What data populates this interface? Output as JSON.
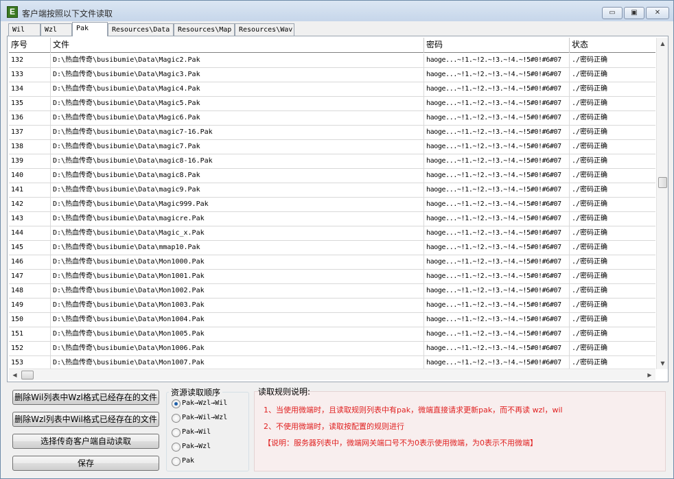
{
  "window": {
    "title": "客户端按照以下文件读取",
    "app_icon": "E",
    "minimize": "▭",
    "maximize": "▣",
    "close": "✕"
  },
  "tabs": [
    {
      "label": "Wil",
      "active": false
    },
    {
      "label": "Wzl",
      "active": false
    },
    {
      "label": "Pak",
      "active": true
    },
    {
      "label": "Resources\\Data",
      "active": false
    },
    {
      "label": "Resources\\Map",
      "active": false
    },
    {
      "label": "Resources\\Wav",
      "active": false
    }
  ],
  "table": {
    "columns": [
      "序号",
      "文件",
      "密码",
      "状态"
    ],
    "rows": [
      {
        "no": "132",
        "file": "D:\\热血传奇\\busibumie\\Data\\Magic2.Pak",
        "password": "haoge...~!1.~!2.~!3.~!4.~!5#0!#6#07",
        "status": "./密码正确"
      },
      {
        "no": "133",
        "file": "D:\\热血传奇\\busibumie\\Data\\Magic3.Pak",
        "password": "haoge...~!1.~!2.~!3.~!4.~!5#0!#6#07",
        "status": "./密码正确"
      },
      {
        "no": "134",
        "file": "D:\\热血传奇\\busibumie\\Data\\Magic4.Pak",
        "password": "haoge...~!1.~!2.~!3.~!4.~!5#0!#6#07",
        "status": "./密码正确"
      },
      {
        "no": "135",
        "file": "D:\\热血传奇\\busibumie\\Data\\Magic5.Pak",
        "password": "haoge...~!1.~!2.~!3.~!4.~!5#0!#6#07",
        "status": "./密码正确"
      },
      {
        "no": "136",
        "file": "D:\\热血传奇\\busibumie\\Data\\Magic6.Pak",
        "password": "haoge...~!1.~!2.~!3.~!4.~!5#0!#6#07",
        "status": "./密码正确"
      },
      {
        "no": "137",
        "file": "D:\\热血传奇\\busibumie\\Data\\magic7-16.Pak",
        "password": "haoge...~!1.~!2.~!3.~!4.~!5#0!#6#07",
        "status": "./密码正确"
      },
      {
        "no": "138",
        "file": "D:\\热血传奇\\busibumie\\Data\\magic7.Pak",
        "password": "haoge...~!1.~!2.~!3.~!4.~!5#0!#6#07",
        "status": "./密码正确"
      },
      {
        "no": "139",
        "file": "D:\\热血传奇\\busibumie\\Data\\magic8-16.Pak",
        "password": "haoge...~!1.~!2.~!3.~!4.~!5#0!#6#07",
        "status": "./密码正确"
      },
      {
        "no": "140",
        "file": "D:\\热血传奇\\busibumie\\Data\\magic8.Pak",
        "password": "haoge...~!1.~!2.~!3.~!4.~!5#0!#6#07",
        "status": "./密码正确"
      },
      {
        "no": "141",
        "file": "D:\\热血传奇\\busibumie\\Data\\magic9.Pak",
        "password": "haoge...~!1.~!2.~!3.~!4.~!5#0!#6#07",
        "status": "./密码正确"
      },
      {
        "no": "142",
        "file": "D:\\热血传奇\\busibumie\\Data\\Magic999.Pak",
        "password": "haoge...~!1.~!2.~!3.~!4.~!5#0!#6#07",
        "status": "./密码正确"
      },
      {
        "no": "143",
        "file": "D:\\热血传奇\\busibumie\\Data\\magicre.Pak",
        "password": "haoge...~!1.~!2.~!3.~!4.~!5#0!#6#07",
        "status": "./密码正确"
      },
      {
        "no": "144",
        "file": "D:\\热血传奇\\busibumie\\Data\\Magic_x.Pak",
        "password": "haoge...~!1.~!2.~!3.~!4.~!5#0!#6#07",
        "status": "./密码正确"
      },
      {
        "no": "145",
        "file": "D:\\热血传奇\\busibumie\\Data\\mmap10.Pak",
        "password": "haoge...~!1.~!2.~!3.~!4.~!5#0!#6#07",
        "status": "./密码正确"
      },
      {
        "no": "146",
        "file": "D:\\热血传奇\\busibumie\\Data\\Mon1000.Pak",
        "password": "haoge...~!1.~!2.~!3.~!4.~!5#0!#6#07",
        "status": "./密码正确"
      },
      {
        "no": "147",
        "file": "D:\\热血传奇\\busibumie\\Data\\Mon1001.Pak",
        "password": "haoge...~!1.~!2.~!3.~!4.~!5#0!#6#07",
        "status": "./密码正确"
      },
      {
        "no": "148",
        "file": "D:\\热血传奇\\busibumie\\Data\\Mon1002.Pak",
        "password": "haoge...~!1.~!2.~!3.~!4.~!5#0!#6#07",
        "status": "./密码正确"
      },
      {
        "no": "149",
        "file": "D:\\热血传奇\\busibumie\\Data\\Mon1003.Pak",
        "password": "haoge...~!1.~!2.~!3.~!4.~!5#0!#6#07",
        "status": "./密码正确"
      },
      {
        "no": "150",
        "file": "D:\\热血传奇\\busibumie\\Data\\Mon1004.Pak",
        "password": "haoge...~!1.~!2.~!3.~!4.~!5#0!#6#07",
        "status": "./密码正确"
      },
      {
        "no": "151",
        "file": "D:\\热血传奇\\busibumie\\Data\\Mon1005.Pak",
        "password": "haoge...~!1.~!2.~!3.~!4.~!5#0!#6#07",
        "status": "./密码正确"
      },
      {
        "no": "152",
        "file": "D:\\热血传奇\\busibumie\\Data\\Mon1006.Pak",
        "password": "haoge...~!1.~!2.~!3.~!4.~!5#0!#6#07",
        "status": "./密码正确"
      },
      {
        "no": "153",
        "file": "D:\\热血传奇\\busibumie\\Data\\Mon1007.Pak",
        "password": "haoge...~!1.~!2.~!3.~!4.~!5#0!#6#07",
        "status": "./密码正确"
      }
    ]
  },
  "scroll": {
    "up": "▲",
    "down": "▼",
    "left": "◀",
    "right": "▶"
  },
  "buttons": {
    "delete_wil": "删除Wil列表中Wzl格式已经存在的文件",
    "delete_wzl": "删除Wzl列表中Wil格式已经存在的文件",
    "auto_read": "选择传奇客户端自动读取",
    "save": "保存"
  },
  "read_order": {
    "title": "资源读取顺序",
    "options": [
      {
        "label": "Pak→Wzl→Wil",
        "selected": true
      },
      {
        "label": "Pak→Wil→Wzl",
        "selected": false
      },
      {
        "label": "Pak→Wil",
        "selected": false
      },
      {
        "label": "Pak→Wzl",
        "selected": false
      },
      {
        "label": "Pak",
        "selected": false
      }
    ]
  },
  "rules": {
    "title": "读取规则说明:",
    "lines": [
      "1、当使用微端时，且读取规则列表中有pak，微端直接请求更新pak，而不再读 wzl，wil",
      "2、不使用微端时，读取按配置的规则进行",
      "【说明：服务器列表中，微端网关端口号不为0表示使用微端，为0表示不用微端】"
    ],
    "color": "#e02020"
  }
}
